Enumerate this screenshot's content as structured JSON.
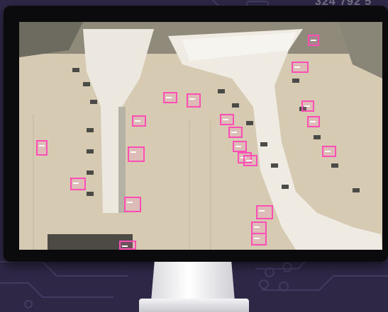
{
  "background": {
    "color": "#2e2746",
    "overlay_number": "324 792 5"
  },
  "monitor": {
    "bezel_color": "#0b0b0d",
    "stand_color": "#e8e8ea"
  },
  "screen_image": {
    "subject": "aerial-airport-terminal-with-detected-aircraft",
    "detection_box_color": "#ff4fb4",
    "detection_count": 24
  }
}
